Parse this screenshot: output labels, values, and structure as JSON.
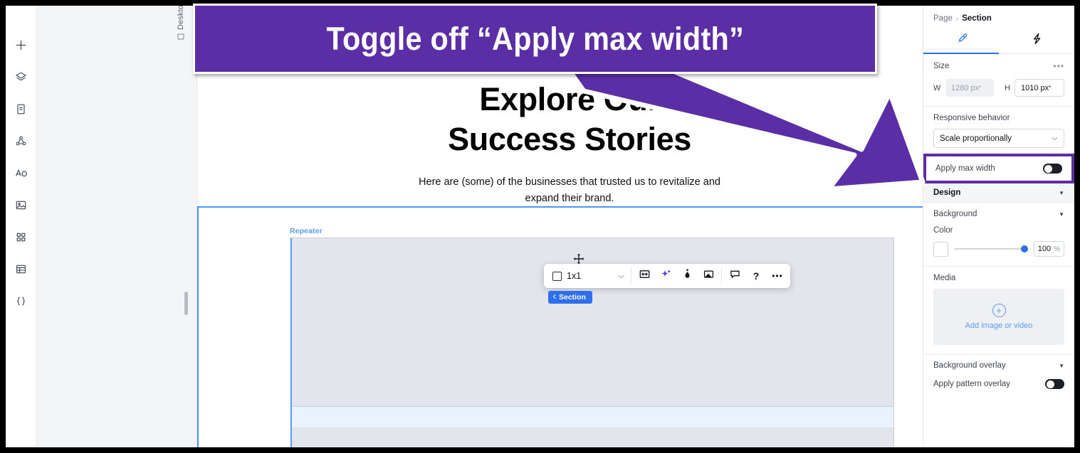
{
  "callout": {
    "text": "Toggle off “Apply max width”",
    "bg_color": "#5B2EA6",
    "arrow_color": "#5B2EA6"
  },
  "left_rail": {
    "items": [
      {
        "name": "add-elements",
        "icon": "plus-icon"
      },
      {
        "name": "layers",
        "icon": "layers-icon"
      },
      {
        "name": "pages",
        "icon": "page-icon"
      },
      {
        "name": "connect-apps",
        "icon": "nodes-icon"
      },
      {
        "name": "text-and-shapes",
        "icon": "text-shapes-icon"
      },
      {
        "name": "media",
        "icon": "image-icon"
      },
      {
        "name": "apps",
        "icon": "grid-apps-icon"
      },
      {
        "name": "tables",
        "icon": "table-icon"
      },
      {
        "name": "dev-mode",
        "icon": "code-braces-icon"
      }
    ]
  },
  "stage": {
    "device_label": "Desktop (Primary)",
    "hero": {
      "heading_line1": "Explore Our",
      "heading_line2": "Success Stories",
      "paragraph": "Here are (some) of the businesses that trusted us to revitalize and expand their brand."
    },
    "repeater_label": "Repeater",
    "section_badge": "Section"
  },
  "floating_toolbar": {
    "ratio_label": "1x1",
    "buttons": [
      {
        "name": "stretch-width-button",
        "icon": "stretch-icon"
      },
      {
        "name": "ai-assistant-button",
        "icon": "sparkle-icon"
      },
      {
        "name": "design-styles-button",
        "icon": "ink-drop-icon"
      },
      {
        "name": "background-button",
        "icon": "image-corner-icon"
      },
      {
        "name": "comment-button",
        "icon": "comment-icon"
      },
      {
        "name": "help-button",
        "icon": "question-icon"
      },
      {
        "name": "more-options-button",
        "icon": "ellipsis-icon"
      }
    ]
  },
  "panel": {
    "breadcrumb": {
      "parent": "Page",
      "separator": "›",
      "current": "Section"
    },
    "tabs": [
      {
        "name": "design-tab",
        "icon": "paintbrush-icon",
        "active": true
      },
      {
        "name": "interactions-tab",
        "icon": "lightning-icon",
        "active": false
      }
    ],
    "size": {
      "title": "Size",
      "more": "•••",
      "w_label": "W",
      "w_value": "1280 px",
      "w_sup": "*",
      "h_label": "H",
      "h_value": "1010 px",
      "h_sup": "*"
    },
    "responsive": {
      "label": "Responsive behavior",
      "selected": "Scale proportionally"
    },
    "apply_max_width": {
      "label": "Apply max width",
      "state": "off",
      "highlight_color": "#5B2EA6"
    },
    "design": {
      "title": "Design"
    },
    "background": {
      "title": "Background",
      "color_label": "Color",
      "opacity_value": "100",
      "opacity_unit": "%",
      "media_label": "Media",
      "media_cta": "Add image or video"
    },
    "background_overlay": {
      "title": "Background overlay"
    },
    "pattern_overlay": {
      "label": "Apply pattern overlay",
      "state": "off"
    }
  }
}
